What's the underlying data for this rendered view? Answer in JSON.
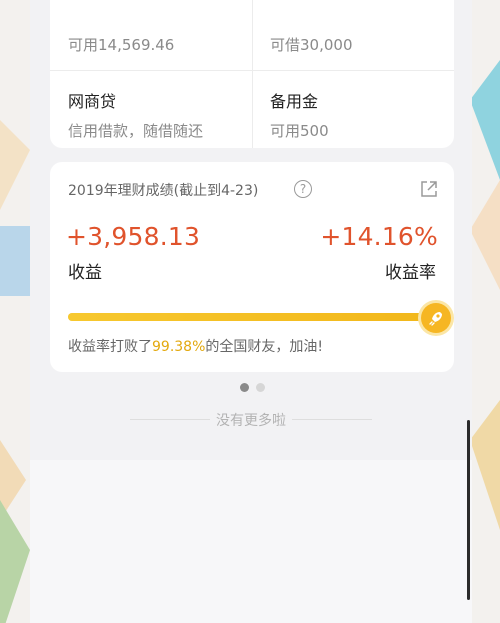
{
  "loans": {
    "cell1_sub": "可用14,569.46",
    "cell2_sub": "可借30,000",
    "cell3_title": "网商贷",
    "cell3_sub": "信用借款，随借随还",
    "cell4_title": "备用金",
    "cell4_sub": "可用500"
  },
  "performance": {
    "title": "2019年理财成绩(截止到4-23)",
    "help_symbol": "?",
    "profit_value": "+3,958.13",
    "profit_label": "收益",
    "rate_value": "+14.16%",
    "rate_label": "收益率",
    "beat_prefix": "收益率打败了",
    "beat_percent": "99.38%",
    "beat_suffix": "的全国财友，加油!",
    "progress_fraction": 0.9938
  },
  "footer": {
    "no_more": "没有更多啦"
  },
  "colors": {
    "accent_red": "#e0532c",
    "accent_gold": "#f6b623"
  },
  "icons": [
    "help-icon",
    "share-icon",
    "rocket-icon"
  ]
}
